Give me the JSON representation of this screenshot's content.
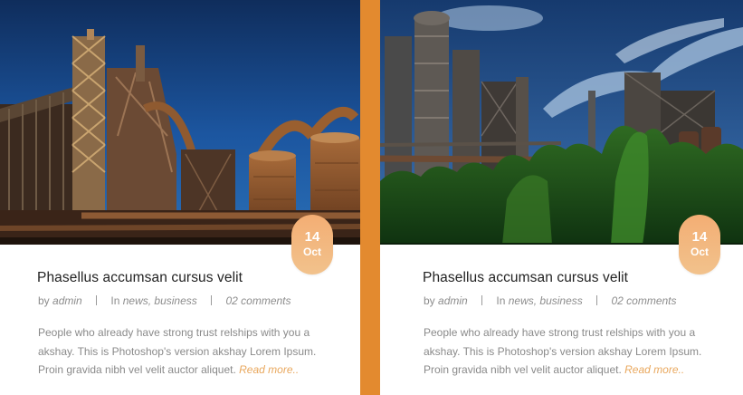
{
  "colors": {
    "accent": "#E38A2F",
    "badge_top": "#F3AE74",
    "badge_bottom": "#F2C28C",
    "read_more": "#E9A85E"
  },
  "posts": [
    {
      "image_icon": "industrial-plant-photo",
      "date_day": "14",
      "date_month": "Oct",
      "title": "Phasellus accumsan cursus velit",
      "by_prefix": "by ",
      "author": "admin",
      "in_prefix": "In ",
      "categories": "news, business",
      "comments": "02 comments",
      "excerpt_line1": "People who already have strong trust relships with you a",
      "excerpt_line2": "akshay. This is Photoshop's version  akshay Lorem Ipsum.",
      "excerpt_line3": "Proin gravida nibh vel velit auctor aliquet. ",
      "read_more": "Read more.."
    },
    {
      "image_icon": "industrial-plant-trees-photo",
      "date_day": "14",
      "date_month": "Oct",
      "title": "Phasellus accumsan cursus velit",
      "by_prefix": "by ",
      "author": "admin",
      "in_prefix": "In ",
      "categories": "news, business",
      "comments": "02 comments",
      "excerpt_line1": "People who already have strong trust relships with you a",
      "excerpt_line2": "akshay. This is Photoshop's version  akshay Lorem Ipsum.",
      "excerpt_line3": "Proin gravida nibh vel velit auctor aliquet. ",
      "read_more": "Read more.."
    }
  ]
}
